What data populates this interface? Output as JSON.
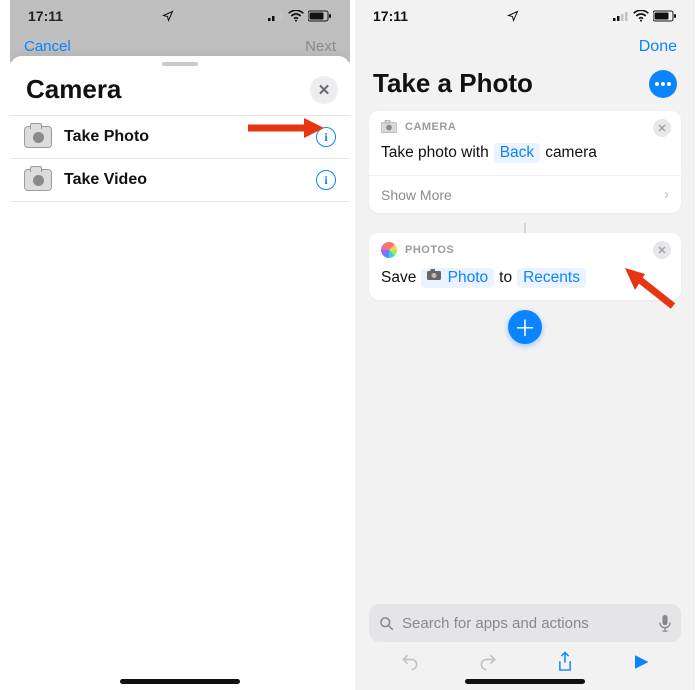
{
  "left": {
    "status_time": "17:11",
    "cancelrow": {
      "cancel": "Cancel",
      "next": "Next"
    },
    "sheet_title": "Camera",
    "actions": [
      {
        "label": "Take Photo"
      },
      {
        "label": "Take Video"
      }
    ]
  },
  "right": {
    "status_time": "17:11",
    "done": "Done",
    "title": "Take a Photo",
    "card_camera": {
      "app_label": "CAMERA",
      "prefix": "Take photo with",
      "token": "Back",
      "suffix": "camera",
      "show_more": "Show More"
    },
    "card_photos": {
      "app_label": "PHOTOS",
      "w1": "Save",
      "token_photo": "Photo",
      "w2": "to",
      "token_recents": "Recents"
    },
    "search_placeholder": "Search for apps and actions"
  }
}
